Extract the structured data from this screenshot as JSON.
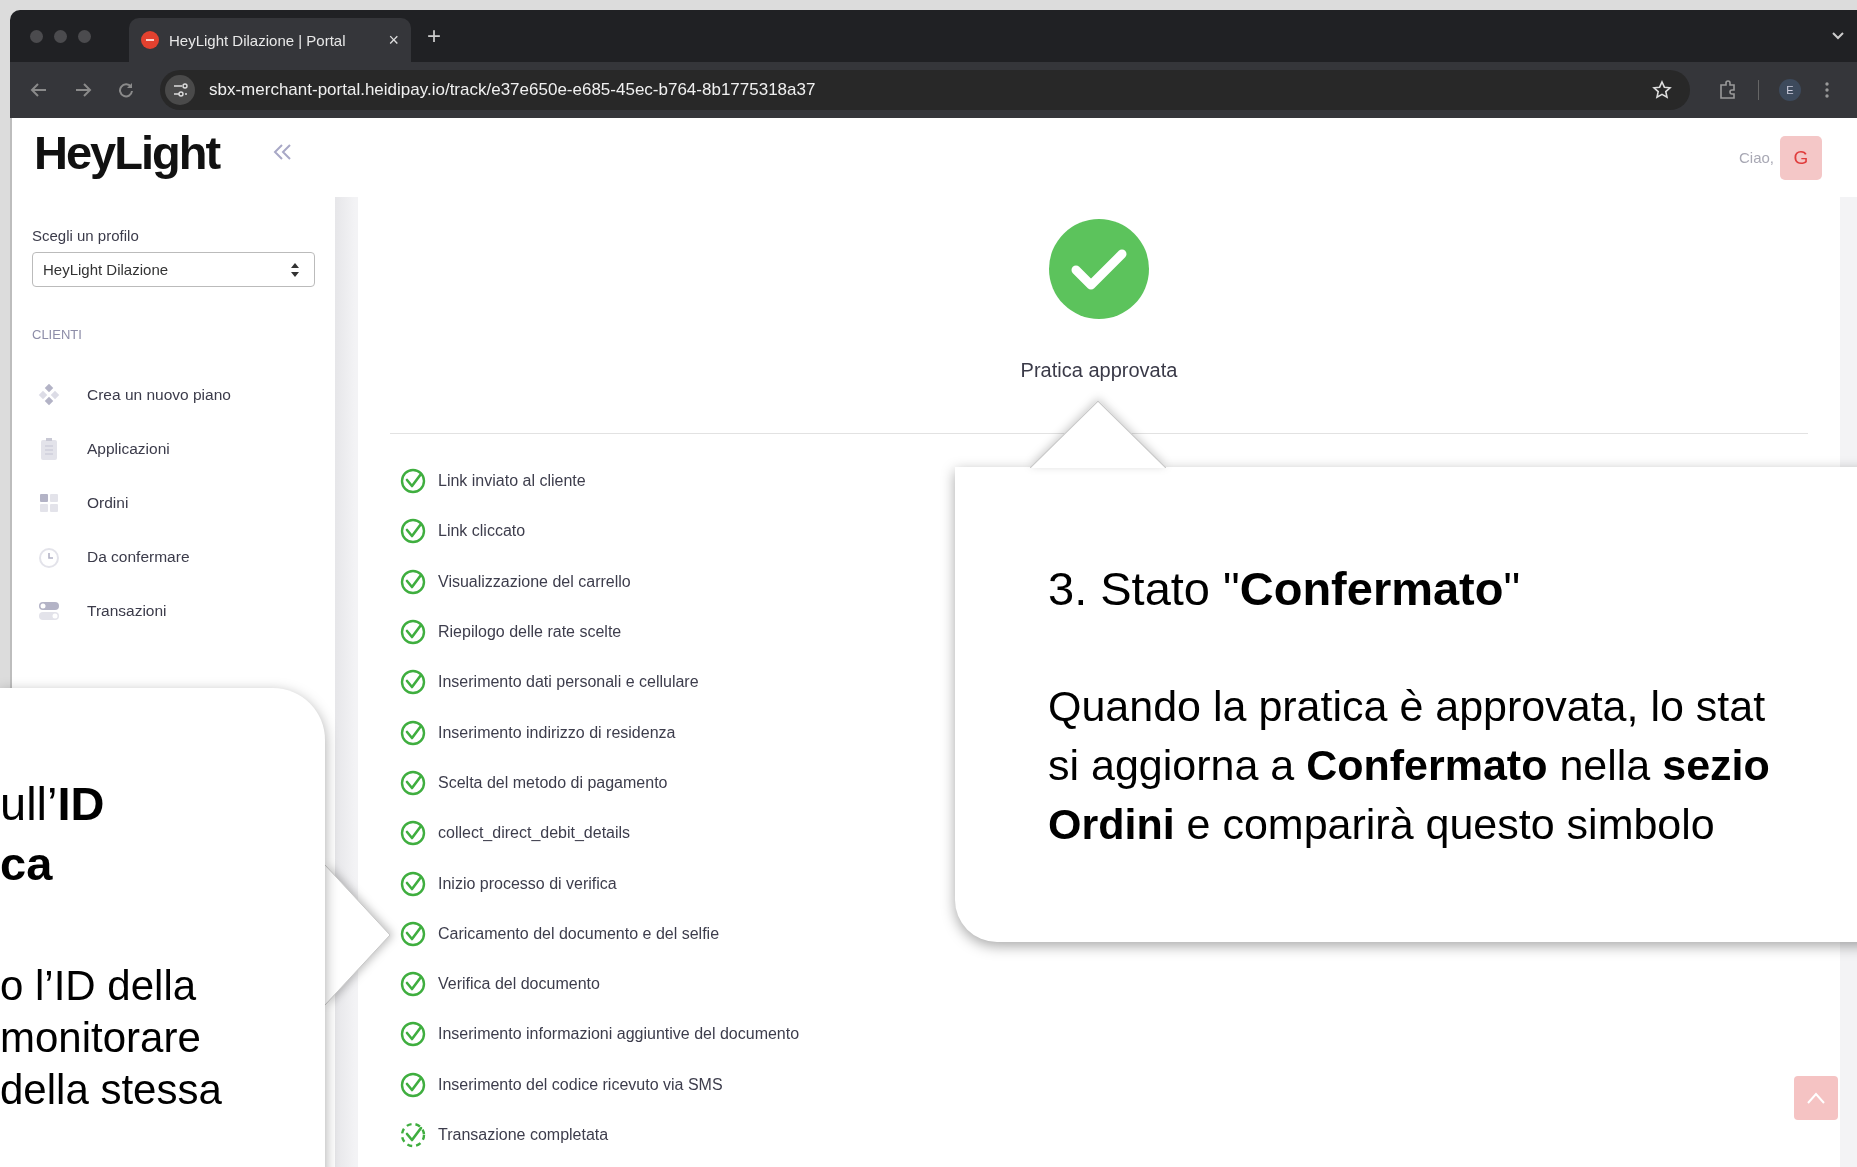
{
  "browser": {
    "tab": {
      "title": "HeyLight Dilazione | Portal",
      "close": "×"
    },
    "new_tab": "+",
    "url": "sbx-merchant-portal.heidipay.io/track/e37e650e-e685-45ec-b764-8b1775318a37",
    "profile_initial": "E"
  },
  "sidebar": {
    "logo": "HeyLight",
    "profile_label": "Scegli un profilo",
    "profile_select": "HeyLight Dilazione",
    "section": "CLIENTI",
    "items": [
      {
        "label": "Crea un nuovo piano"
      },
      {
        "label": "Applicazioni"
      },
      {
        "label": "Ordini"
      },
      {
        "label": "Da confermare"
      },
      {
        "label": "Transazioni"
      }
    ]
  },
  "header": {
    "greeting": "Ciao,",
    "avatar": "G"
  },
  "status": {
    "title": "Pratica approvata"
  },
  "steps": [
    {
      "label": "Link inviato al cliente",
      "completed": true
    },
    {
      "label": "Link cliccato",
      "completed": true
    },
    {
      "label": "Visualizzazione del carrello",
      "completed": true
    },
    {
      "label": "Riepilogo delle rate scelte",
      "completed": true
    },
    {
      "label": "Inserimento dati personali e cellulare",
      "completed": true
    },
    {
      "label": "Inserimento indirizzo di residenza",
      "completed": true
    },
    {
      "label": "Scelta del metodo di pagamento",
      "completed": true
    },
    {
      "label": "collect_direct_debit_details",
      "completed": true
    },
    {
      "label": "Inizio processo di verifica",
      "completed": true
    },
    {
      "label": "Caricamento del documento e del selfie",
      "completed": true
    },
    {
      "label": "Verifica del documento",
      "completed": true
    },
    {
      "label": "Inserimento informazioni aggiuntive del documento",
      "completed": true
    },
    {
      "label": "Inserimento del codice ricevuto via SMS",
      "completed": true
    },
    {
      "label": "Transazione completata",
      "completed": false
    }
  ],
  "callouts": [
    {
      "title_lines": [
        "ull’**ID**",
        "**ca**"
      ],
      "body_lines": [
        "o l’ID della",
        " monitorare",
        " della stessa"
      ]
    },
    {
      "title_lines": [
        "3. Stato \"**Confermato**\""
      ],
      "body_lines": [
        "Quando la pratica è approvata, lo stat",
        "si aggiorna a **Confermato** nella **sezio**",
        "**Ordini** e comparirà questo simbolo"
      ]
    }
  ]
}
